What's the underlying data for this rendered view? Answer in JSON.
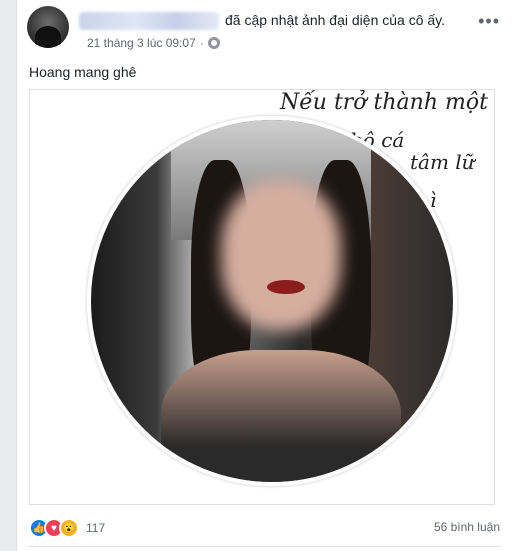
{
  "post": {
    "action_text": "đã cập nhật ảnh đại diện của cô ấy.",
    "timestamp": "21 tháng 3 lúc 09:07",
    "more": "•••",
    "status_text": "Hoang mang ghê",
    "photo": {
      "handwriting": [
        "Nếu trở thành một",
        "bộ cá",
        "tâm lữ",
        "ì"
      ]
    },
    "reactions": {
      "count": "117",
      "types": [
        "like-icon",
        "love-icon",
        "wow-icon"
      ],
      "comments": "56 bình luận"
    }
  }
}
